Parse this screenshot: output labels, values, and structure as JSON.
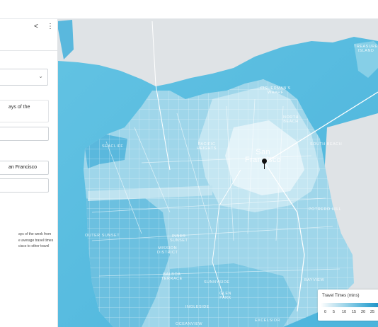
{
  "sidebar": {
    "icons": [
      "share-icon",
      "more-vert-icon"
    ],
    "card_text": "ays of the",
    "location_value": "an Francisco",
    "description_lines": [
      "ays of the week from",
      "e average travel times",
      "cisco to other travel"
    ]
  },
  "map": {
    "labels": {
      "treasure_island": "TREASURE\nISLAND",
      "fishermans_wharf": "FISHERMAN'S\nWHARF",
      "north_beach": "NORTH\nBEACH",
      "seacliff": "SEACLIFF",
      "pacific_heights": "PACIFIC\nHEIGHTS",
      "san_francisco": "San\nFrancisco",
      "south_beach": "SOUTH BEACH",
      "inner_sunset": "INNER\nSUNSET",
      "mission_district": "MISSION\nDISTRICT",
      "balboa_terrace": "BALBOA\nTERRACE",
      "outer_sunset": "OUTER SUNSET",
      "sunnyside": "SUNNYSIDE",
      "potrero_hill": "POTRERO HILL",
      "ingleside": "INGLESIDE",
      "excelsior": "EXCELSIOR",
      "oceanview": "OCEANVIEW",
      "glen_park": "GLEN\nPARK",
      "bayview": "BAYVIEW"
    },
    "colors": {
      "water": "#5bbfe1",
      "land_gray": "#dfe3e6",
      "tract_light": "#cfeaf4",
      "tract_mid": "#8fd0e8",
      "tract_dark": "#4fb2da",
      "road": "#ffffff"
    }
  },
  "legend": {
    "title": "Travel Times (mins)",
    "ticks": [
      "0",
      "5",
      "10",
      "15",
      "20",
      "25"
    ]
  }
}
